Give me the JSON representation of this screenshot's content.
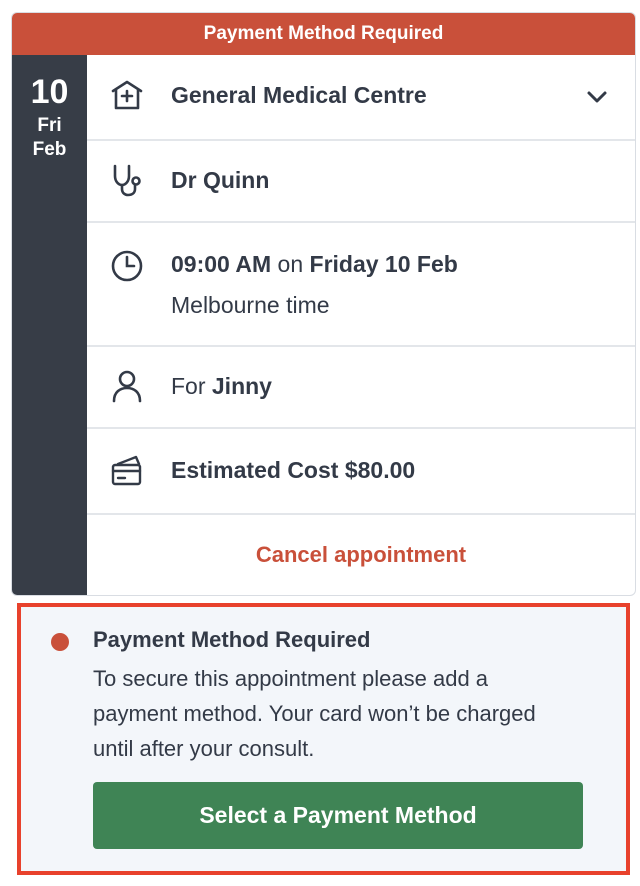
{
  "banner": {
    "title": "Payment Method Required"
  },
  "date": {
    "day": "10",
    "weekday": "Fri",
    "month": "Feb"
  },
  "details": {
    "clinic": "General Medical Centre",
    "doctor": "Dr Quinn",
    "time": "09:00 AM",
    "on_word": "on",
    "date_text": "Friday 10 Feb",
    "timezone": "Melbourne time",
    "for_word": "For",
    "patient": "Jinny",
    "cost": "Estimated Cost $80.00"
  },
  "actions": {
    "cancel": "Cancel appointment"
  },
  "notice": {
    "title": "Payment Method Required",
    "body": "To secure this appointment please add a payment method. Your card won’t be charged until after your consult.",
    "button": "Select a Payment Method"
  },
  "colors": {
    "accent_red": "#c9503a",
    "date_dark": "#373d47",
    "button_green": "#3f8455",
    "highlight_border": "#e8412c"
  },
  "icons": [
    "clinic-icon",
    "chevron-down-icon",
    "stethoscope-icon",
    "clock-icon",
    "person-icon",
    "credit-card-icon",
    "status-dot-icon"
  ]
}
